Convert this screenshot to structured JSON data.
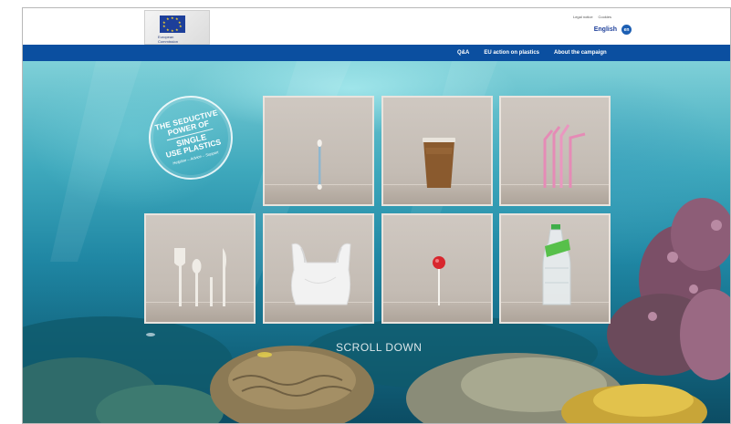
{
  "header": {
    "logo": {
      "line1": "European",
      "line2": "Commission"
    },
    "legal_links": [
      "Legal notice",
      "Cookies"
    ],
    "language": {
      "label": "English",
      "icon": "en"
    }
  },
  "nav": {
    "items": [
      "Q&A",
      "EU action on plastics",
      "About the campaign"
    ]
  },
  "badge": {
    "line1": "THE SEDUCTIVE",
    "line2": "POWER OF",
    "line3": "SINGLE",
    "line4": "USE PLASTICS",
    "tagline": "Helpline – Advice – Support"
  },
  "tiles": [
    "cotton-bud",
    "coffee-cup",
    "straws",
    "cutlery",
    "plastic-bag",
    "lollipop",
    "plastic-bottle"
  ],
  "scroll_label": "SCROLL DOWN",
  "colors": {
    "nav": "#0b4fa0",
    "brand": "#1d3f9a"
  }
}
